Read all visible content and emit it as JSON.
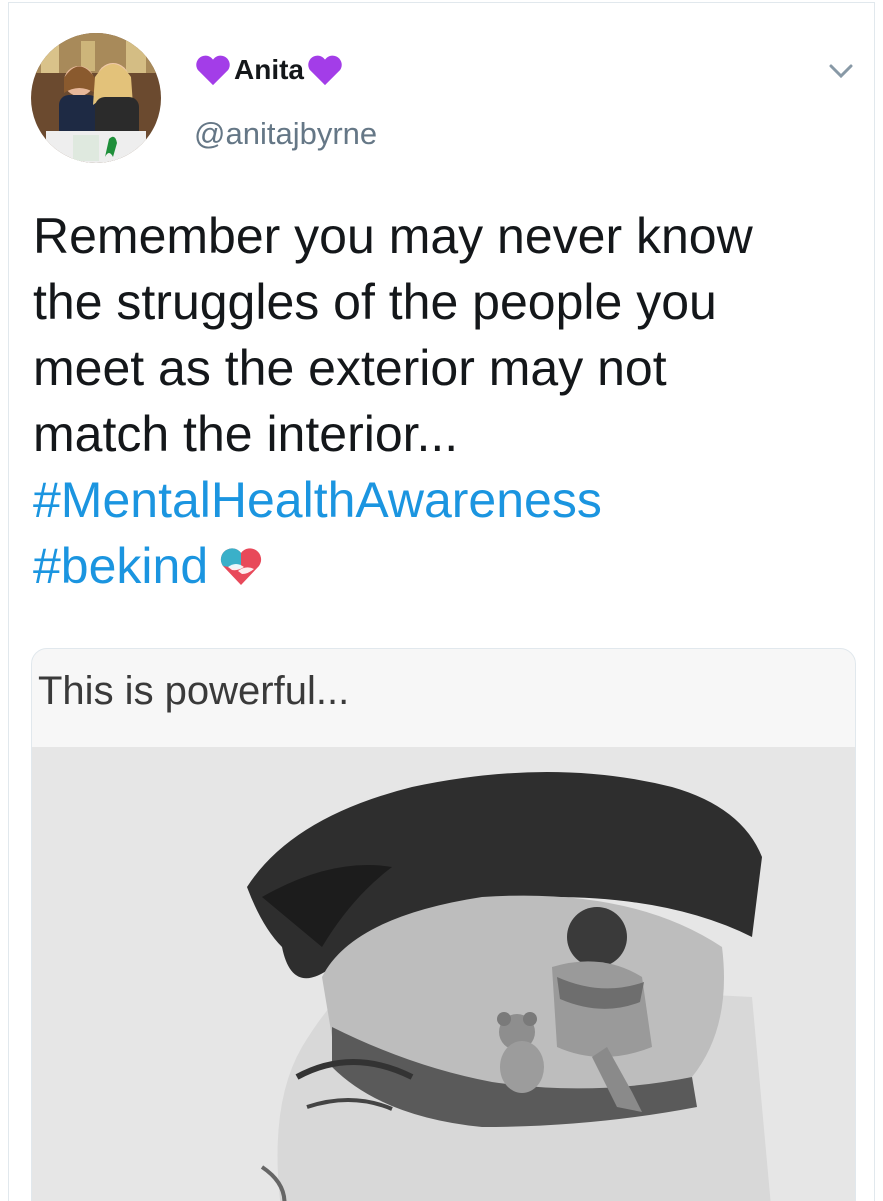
{
  "tweet": {
    "author": {
      "name": "Anita",
      "handle": "@anitajbyrne",
      "name_heart_color": "#a33de8"
    },
    "text_lines": [
      "Remember you may never know",
      "the struggles of the people you",
      "meet as the exterior may not",
      "match the interior..."
    ],
    "hashtags": [
      "#MentalHealthAwareness",
      "#bekind"
    ],
    "trailing_emoji": "heart-with-hands",
    "media": {
      "caption": "This is powerful..."
    },
    "menu_icon": "chevron-down-icon"
  },
  "colors": {
    "link": "#1b95e0",
    "handle": "#657786",
    "text": "#14171a"
  }
}
